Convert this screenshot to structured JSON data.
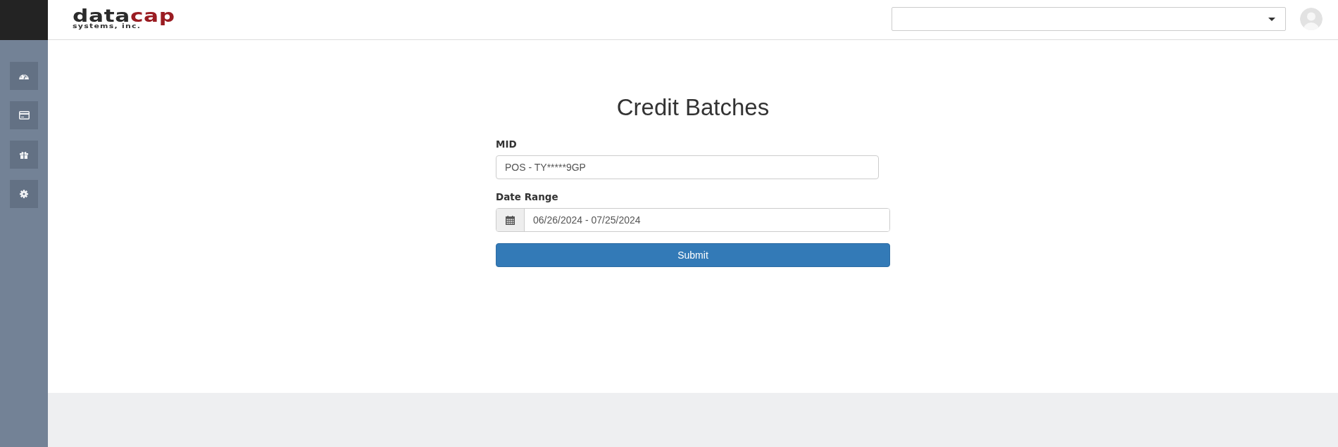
{
  "logo": {
    "word_dark": "data",
    "word_accent": "cap",
    "tagline": "systems, inc."
  },
  "page": {
    "title": "Credit Batches"
  },
  "form": {
    "fields": [
      {
        "kind": "text",
        "label": "MID",
        "value": "POS - TY*****9GP"
      },
      {
        "kind": "date_range",
        "label": "Date Range",
        "value": "06/26/2024 - 07/25/2024"
      }
    ],
    "submit": "Submit"
  }
}
